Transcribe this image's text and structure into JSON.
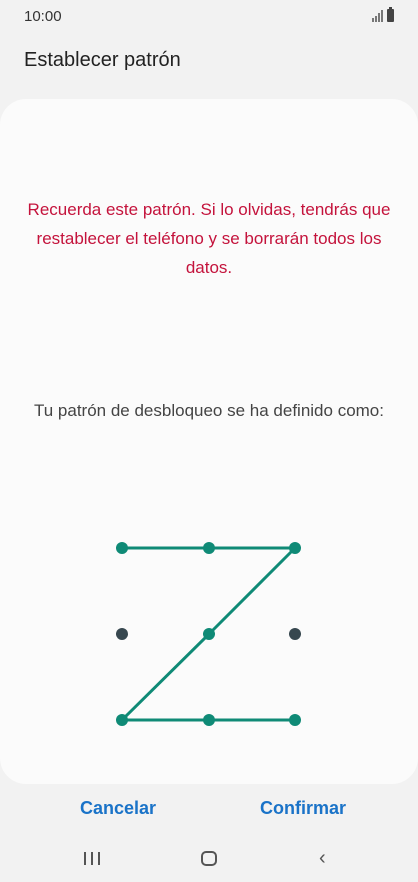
{
  "status_bar": {
    "time": "10:00",
    "icons": [
      "signal-icon",
      "battery-icon"
    ]
  },
  "header": {
    "title": "Establecer patrón"
  },
  "content": {
    "warning": "Recuerda este patrón. Si lo olvidas, tendrás que restablecer el teléfono y se borrarán todos los datos.",
    "subtitle": "Tu patrón de desbloqueo se ha definido como:",
    "pattern_sequence": [
      1,
      2,
      3,
      5,
      7,
      8,
      9
    ]
  },
  "actions": {
    "cancel": "Cancelar",
    "confirm": "Confirmar"
  },
  "nav_bar": {
    "icons": [
      "recent-apps-icon",
      "home-icon",
      "back-icon"
    ]
  },
  "colors": {
    "accent": "#0f8a76",
    "dot_inactive": "#37474f",
    "warning": "#c4133c",
    "button": "#1a73c8"
  }
}
